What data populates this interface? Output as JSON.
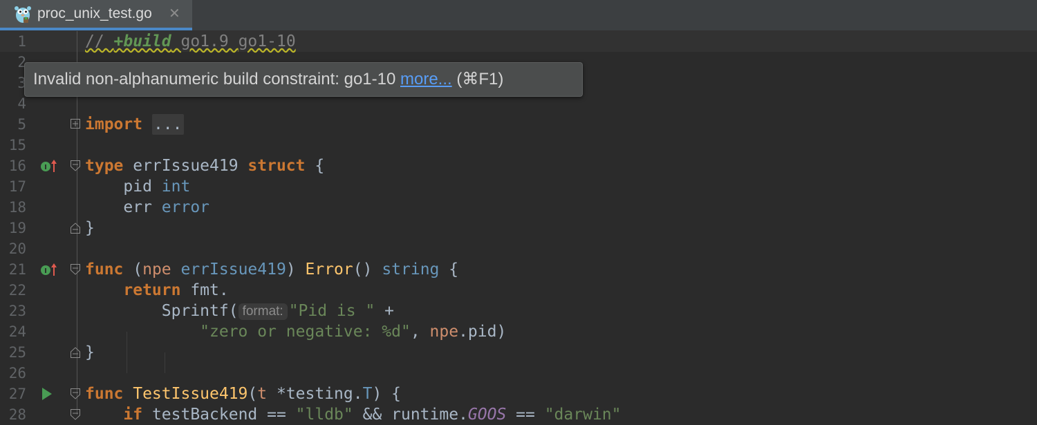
{
  "tab": {
    "filename": "proc_unix_test.go",
    "close_glyph": "✕"
  },
  "tooltip": {
    "message": "Invalid non-alphanumeric build constraint: go1-10 ",
    "link": "more...",
    "shortcut": " (⌘F1)"
  },
  "gutter": {
    "line_numbers": [
      "1",
      "2",
      "3",
      "4",
      "5",
      "15",
      "16",
      "17",
      "18",
      "19",
      "20",
      "21",
      "22",
      "23",
      "24",
      "25",
      "26",
      "27",
      "28"
    ]
  },
  "code": {
    "l1_comment": "// ",
    "l1_build": "+build",
    "l1_v1": " go1.9 ",
    "l1_v2": "go1-10",
    "l5_import": "import",
    "l5_fold": "...",
    "l16_type": "type",
    "l16_name": " errIssue419 ",
    "l16_struct": "struct",
    "l16_brace": " {",
    "l17_field": "    pid ",
    "l17_type": "int",
    "l18_field": "    err ",
    "l18_type": "error",
    "l19": "}",
    "l21_func": "func",
    "l21_open": " (",
    "l21_recv": "npe",
    "l21_recvtype": " errIssue419",
    "l21_close": ") ",
    "l21_name": "Error",
    "l21_parens": "() ",
    "l21_ret": "string",
    "l21_brace": " {",
    "l22_indent": "    ",
    "l22_return": "return",
    "l22_rest": " fmt.",
    "l23_call": "        Sprintf(",
    "l23_hint": "format:",
    "l23_str": "\"Pid is \"",
    "l23_plus": " +",
    "l24_indent": "            ",
    "l24_str": "\"zero or negative: %d\"",
    "l24_comma": ", ",
    "l24_npe": "npe",
    "l24_rest": ".pid)",
    "l25": "}",
    "l27_func": "func",
    "l27_name": " TestIssue419",
    "l27_open": "(",
    "l27_t": "t",
    "l27_type": " *testing.",
    "l27_T": "T",
    "l27_rest": ") {",
    "l28_indent": "    ",
    "l28_if": "if",
    "l28_a": " testBackend == ",
    "l28_s1": "\"lldb\"",
    "l28_b": " && runtime.",
    "l28_goos": "GOOS",
    "l28_c": " == ",
    "l28_s2": "\"darwin\"",
    "l28_d": " "
  },
  "colors": {
    "keyword": "#cc7832",
    "type": "#6897bb",
    "string": "#6a8759",
    "function": "#ffc66d",
    "background": "#2b2b2b",
    "link": "#589df6"
  },
  "icons": [
    "gopher-icon",
    "implemented-interface-icon",
    "run-icon",
    "fold-icon"
  ]
}
